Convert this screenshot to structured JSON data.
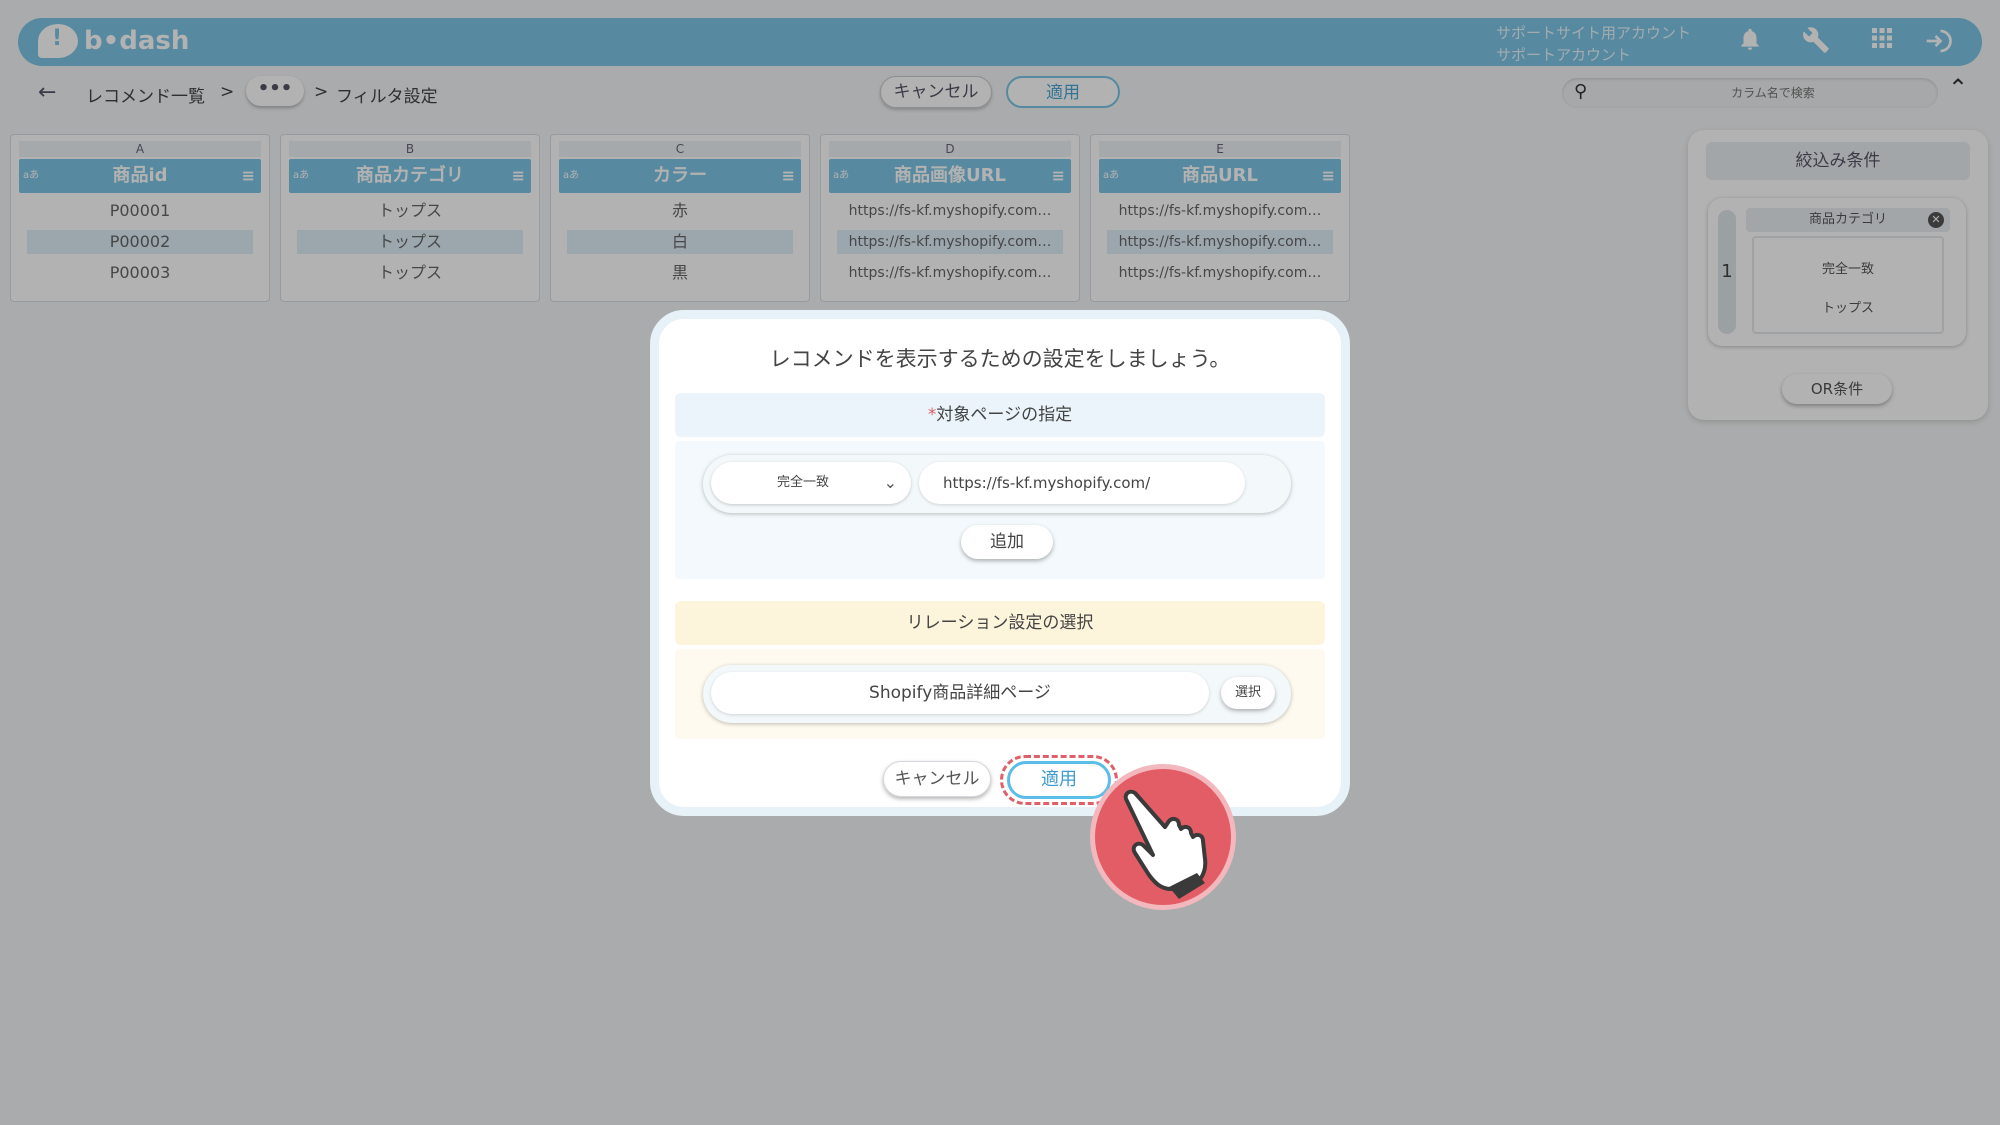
{
  "header": {
    "logo_text": "b•dash",
    "account_line1": "サポートサイト用アカウント",
    "account_line2": "サポートアカウント",
    "icons": [
      "bell-icon",
      "wrench-icon",
      "apps-grid-icon",
      "logout-icon"
    ]
  },
  "toolbar": {
    "breadcrumb_root": "レコメンド一覧",
    "breadcrumb_sep": ">",
    "breadcrumb_more": "•••",
    "breadcrumb_current": "フィルタ設定",
    "cancel_label": "キャンセル",
    "apply_label": "適用",
    "search_placeholder": "カラム名で検索"
  },
  "columns": [
    {
      "letter": "A",
      "type": "aあ",
      "name": "商品id",
      "cells": [
        "P00001",
        "P00002",
        "P00003"
      ]
    },
    {
      "letter": "B",
      "type": "aあ",
      "name": "商品カテゴリ",
      "cells": [
        "トップス",
        "トップス",
        "トップス"
      ]
    },
    {
      "letter": "C",
      "type": "aあ",
      "name": "カラー",
      "cells": [
        "赤",
        "白",
        "黒"
      ]
    },
    {
      "letter": "D",
      "type": "aあ",
      "name": "商品画像URL",
      "cells": [
        "https://fs-kf.myshopify.com…",
        "https://fs-kf.myshopify.com…",
        "https://fs-kf.myshopify.com…"
      ]
    },
    {
      "letter": "E",
      "type": "aあ",
      "name": "商品URL",
      "cells": [
        "https://fs-kf.myshopify.com…",
        "https://fs-kf.myshopify.com…",
        "https://fs-kf.myshopify.com…"
      ]
    }
  ],
  "filter_panel": {
    "title": "絞込み条件",
    "group_number": "1",
    "condition_column": "商品カテゴリ",
    "condition_operator": "完全一致",
    "condition_value": "トップス",
    "or_label": "OR条件"
  },
  "modal": {
    "title": "レコメンドを表示するための設定をしましょう。",
    "section1_required_mark": "*",
    "section1_title": "対象ページの指定",
    "match_select_value": "完全一致",
    "url_value": "https://fs-kf.myshopify.com/",
    "add_label": "追加",
    "section2_title": "リレーション設定の選択",
    "relation_value": "Shopify商品詳細ページ",
    "select_label": "選択",
    "cancel_label": "キャンセル",
    "apply_label": "適用"
  },
  "colors": {
    "accent": "#7dc5e6",
    "highlight": "#e0606a"
  }
}
